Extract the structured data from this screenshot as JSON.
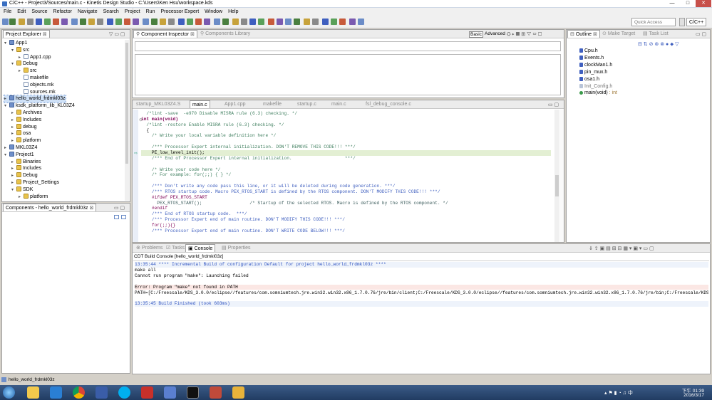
{
  "window": {
    "title": "C/C++ - Project3/Sources/main.c - Kinetis Design Studio - C:\\Users\\Ken Hsu\\workspace.kds",
    "min": "—",
    "max": "□",
    "close": "✕"
  },
  "menu": [
    "File",
    "Edit",
    "Source",
    "Refactor",
    "Navigate",
    "Search",
    "Project",
    "Run",
    "Processor Expert",
    "Window",
    "Help"
  ],
  "toolbar": {
    "quick_access_placeholder": "Quick Access",
    "perspective": "C/C++"
  },
  "project_explorer": {
    "tab": "Project Explorer",
    "items": [
      {
        "indent": 0,
        "tri": "▾",
        "icon": "proj",
        "label": "App1"
      },
      {
        "indent": 1,
        "tri": "▾",
        "icon": "fold",
        "label": "src"
      },
      {
        "indent": 2,
        "tri": "▸",
        "icon": "file",
        "label": "App1.cpp"
      },
      {
        "indent": 1,
        "tri": "▾",
        "icon": "fold",
        "label": "Debug"
      },
      {
        "indent": 2,
        "tri": "▸",
        "icon": "fold",
        "label": "src"
      },
      {
        "indent": 2,
        "tri": "",
        "icon": "file",
        "label": "makefile"
      },
      {
        "indent": 2,
        "tri": "",
        "icon": "file",
        "label": "objects.mk"
      },
      {
        "indent": 2,
        "tri": "",
        "icon": "file",
        "label": "sources.mk"
      },
      {
        "indent": 0,
        "tri": "▸",
        "icon": "proj",
        "label": "hello_world_frdmkl03z"
      },
      {
        "indent": 0,
        "tri": "▾",
        "icon": "proj",
        "label": "ksdk_platform_lib_KL03Z4"
      },
      {
        "indent": 1,
        "tri": "▸",
        "icon": "fold",
        "label": "Archives"
      },
      {
        "indent": 1,
        "tri": "▸",
        "icon": "fold",
        "label": "Includes"
      },
      {
        "indent": 1,
        "tri": "▸",
        "icon": "fold",
        "label": "debug"
      },
      {
        "indent": 1,
        "tri": "▸",
        "icon": "fold",
        "label": "osa"
      },
      {
        "indent": 1,
        "tri": "▸",
        "icon": "fold",
        "label": "platform"
      },
      {
        "indent": 0,
        "tri": "▸",
        "icon": "proj",
        "label": "MKL03Z4"
      },
      {
        "indent": 0,
        "tri": "▾",
        "icon": "proj",
        "label": "Project1"
      },
      {
        "indent": 1,
        "tri": "▸",
        "icon": "fold",
        "label": "Binaries"
      },
      {
        "indent": 1,
        "tri": "▸",
        "icon": "fold",
        "label": "Includes"
      },
      {
        "indent": 1,
        "tri": "▸",
        "icon": "fold",
        "label": "Debug"
      },
      {
        "indent": 1,
        "tri": "▸",
        "icon": "fold",
        "label": "Project_Settings"
      },
      {
        "indent": 1,
        "tri": "▾",
        "icon": "fold",
        "label": "SDK"
      },
      {
        "indent": 2,
        "tri": "▸",
        "icon": "fold",
        "label": "platform"
      }
    ]
  },
  "components_panel": {
    "tab": "Components - hello_world_frdmkl03z"
  },
  "component_inspector": {
    "tab_active": "Component Inspector",
    "tab_inactive": "Components Library",
    "basic": "Basic",
    "advanced": "Advanced"
  },
  "editor": {
    "tabs": [
      "startup_MKL03Z4.S",
      "main.c",
      "App1.cpp",
      "makefile",
      "startup.c",
      "main.c",
      "fsl_debug_console.c"
    ],
    "active_tab": 1,
    "lines": [
      {
        "t": "  /*lint -save  -e970 Disable MISRA rule (6.3) checking. */",
        "c": "cm"
      },
      {
        "t": "int main(void)",
        "c": "kw"
      },
      {
        "t": "  /*lint -restore Enable MISRA rule (6.3) checking. */",
        "c": "cm"
      },
      {
        "t": "  {",
        "c": ""
      },
      {
        "t": "    /* Write your local variable definition here */",
        "c": "cm"
      },
      {
        "t": "",
        "c": ""
      },
      {
        "t": "    /*** Processor Expert internal initialization. DON'T REMOVE THIS CODE!!! ***/",
        "c": "cm"
      },
      {
        "t": "    PE_low_level_init();",
        "c": "hl"
      },
      {
        "t": "    /*** End of Processor Expert internal initialization.                    ***/",
        "c": "cm"
      },
      {
        "t": "",
        "c": ""
      },
      {
        "t": "    /* Write your code here */",
        "c": "cm"
      },
      {
        "t": "    /* For example: for(;;) { } */",
        "c": "cm"
      },
      {
        "t": "",
        "c": ""
      },
      {
        "t": "    /*** Don't write any code pass this line, or it will be deleted during code generation. ***/",
        "c": "cb"
      },
      {
        "t": "    /*** RTOS startup code. Macro PEX_RTOS_START is defined by the RTOS component. DON'T MODIFY THIS CODE!!! ***/",
        "c": "cb"
      },
      {
        "t": "    #ifdef PEX_RTOS_START",
        "c": "mac"
      },
      {
        "t": "      PEX_RTOS_START();                  /* Startup of the selected RTOS. Macro is defined by the RTOS component. */",
        "c": "mix"
      },
      {
        "t": "    #endif",
        "c": "mac"
      },
      {
        "t": "    /*** End of RTOS startup code.  ***/",
        "c": "cb"
      },
      {
        "t": "    /*** Processor Expert end of main routine. DON'T MODIFY THIS CODE!!! ***/",
        "c": "cb"
      },
      {
        "t": "    for(;;){}",
        "c": "kw2"
      },
      {
        "t": "    /*** Processor Expert end of main routine. DON'T WRITE CODE BELOW!!! ***/",
        "c": "cb"
      }
    ]
  },
  "outline": {
    "tabs": [
      "Outline",
      "Make Target",
      "Task List"
    ],
    "items": [
      {
        "label": "Cpu.h",
        "kind": "inc"
      },
      {
        "label": "Events.h",
        "kind": "inc"
      },
      {
        "label": "clockMan1.h",
        "kind": "inc"
      },
      {
        "label": "pin_mux.h",
        "kind": "inc"
      },
      {
        "label": "osa1.h",
        "kind": "inc"
      },
      {
        "label": "Init_Config.h",
        "kind": "inc-gray"
      },
      {
        "label": "main(void)",
        "type": " : int",
        "kind": "fn"
      }
    ]
  },
  "bottom": {
    "tabs": [
      "Problems",
      "Tasks",
      "Console",
      "Properties"
    ],
    "active_tab": 2,
    "console_title": "CDT Build Console [hello_world_frdmkl03z]",
    "lines": [
      {
        "t": "13:35:44 **** Incremental Build of configuration Default for project hello_world_frdmkl03z ****",
        "c": "blue",
        "bg": "#eef3fb"
      },
      {
        "t": "make all",
        "c": "",
        "bg": ""
      },
      {
        "t": "Cannot run program \"make\": Launching failed",
        "c": "",
        "bg": ""
      },
      {
        "t": "",
        "c": "",
        "bg": ""
      },
      {
        "t": "Error: Program \"make\" not found in PATH",
        "c": "",
        "bg": "#fbe7e4"
      },
      {
        "t": "PATH=[C:/Freescale/KDS_3.0.0/eclipse//features/com.somniumtech.jre.win32.win32.x86_1.7.0.76/jre/bin/client;C:/Freescale/KDS_3.0.0/eclipse//features/com.somniumtech.jre.win32.win32.x86_1.7.0.76/jre/bin;C:/Freescale/KDS_3.",
        "c": "",
        "bg": ""
      },
      {
        "t": "",
        "c": "",
        "bg": ""
      },
      {
        "t": "13:35:45 Build Finished (took 603ms)",
        "c": "blue",
        "bg": "#eef3fb"
      }
    ]
  },
  "statusbar": {
    "text": "hello_world_frdmkl03z"
  },
  "taskbar": {
    "time": "下午 01:39",
    "date": "2016/3/17"
  },
  "colors": {
    "accent": "#3f5fbf",
    "selection": "#cfe1f7",
    "highlight_line": "#e8f2fe"
  }
}
